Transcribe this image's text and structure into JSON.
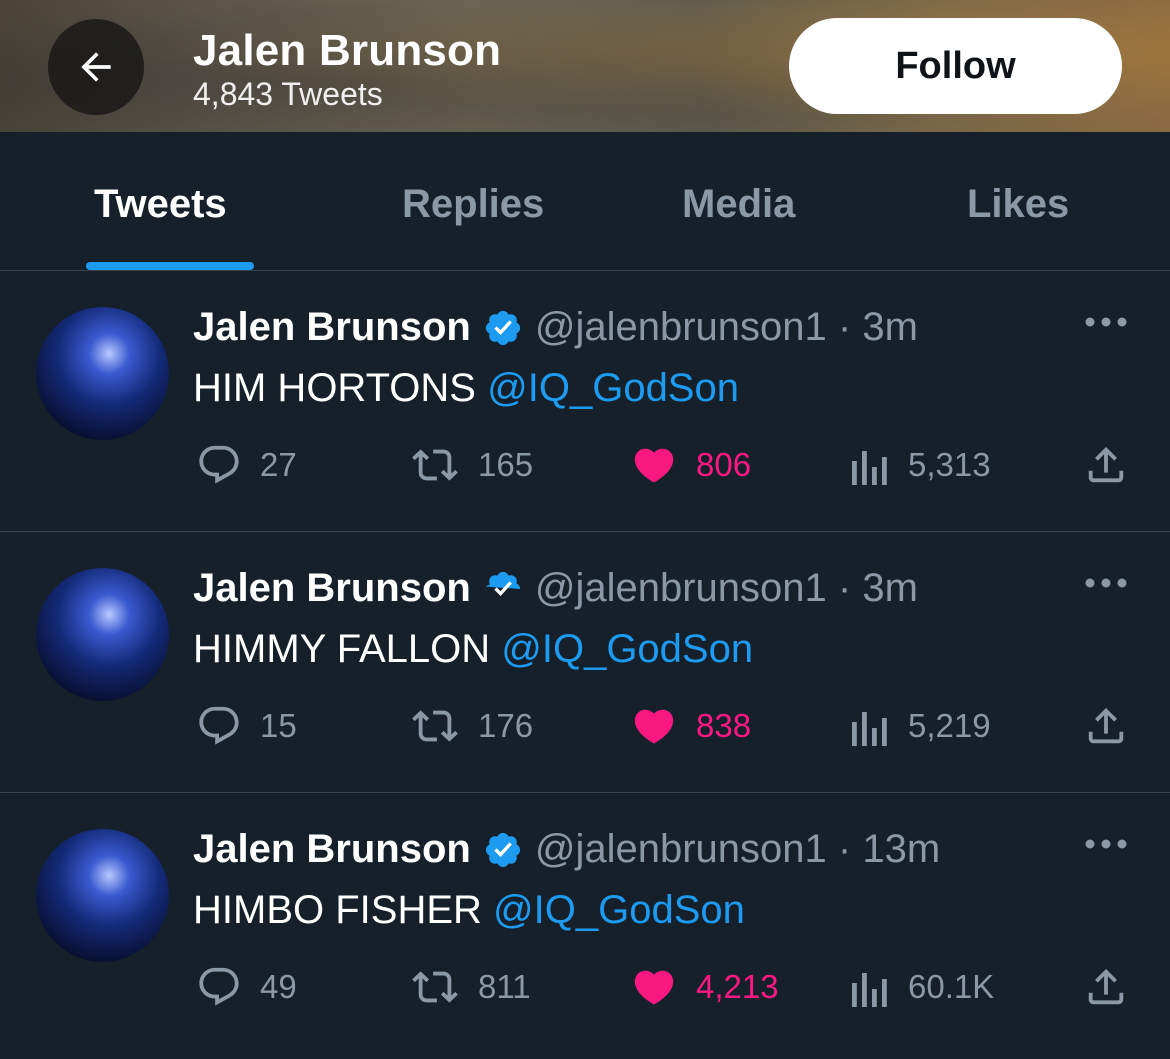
{
  "header": {
    "title": "Jalen Brunson",
    "subtitle": "4,843 Tweets",
    "follow_label": "Follow"
  },
  "tabs": [
    {
      "label": "Tweets",
      "active": true
    },
    {
      "label": "Replies",
      "active": false
    },
    {
      "label": "Media",
      "active": false
    },
    {
      "label": "Likes",
      "active": false
    }
  ],
  "tweets": [
    {
      "author": "Jalen Brunson",
      "handle": "@jalenbrunson1",
      "sep": "·",
      "time": "3m",
      "text": "HIM HORTONS",
      "mention": "@IQ_GodSon",
      "replies": "27",
      "retweets": "165",
      "likes": "806",
      "views": "5,313"
    },
    {
      "author": "Jalen Brunson",
      "handle": "@jalenbrunson1",
      "sep": "·",
      "time": "3m",
      "text": "HIMMY FALLON",
      "mention": "@IQ_GodSon",
      "replies": "15",
      "retweets": "176",
      "likes": "838",
      "views": "5,219"
    },
    {
      "author": "Jalen Brunson",
      "handle": "@jalenbrunson1",
      "sep": "·",
      "time": "13m",
      "text": "HIMBO FISHER",
      "mention": "@IQ_GodSon",
      "replies": "49",
      "retweets": "811",
      "likes": "4,213",
      "views": "60.1K"
    }
  ],
  "icons": {
    "back": "arrow-left-icon",
    "verified": "verified-badge-icon",
    "more": "more-horizontal-icon",
    "reply": "reply-bubble-icon",
    "retweet": "retweet-icon",
    "like": "heart-icon",
    "views": "views-bar-chart-icon",
    "share": "share-upload-icon"
  },
  "colors": {
    "background": "#15202b",
    "accent": "#1d9bf0",
    "like": "#f91880",
    "muted": "#8b98a5",
    "divider": "#38444d"
  }
}
